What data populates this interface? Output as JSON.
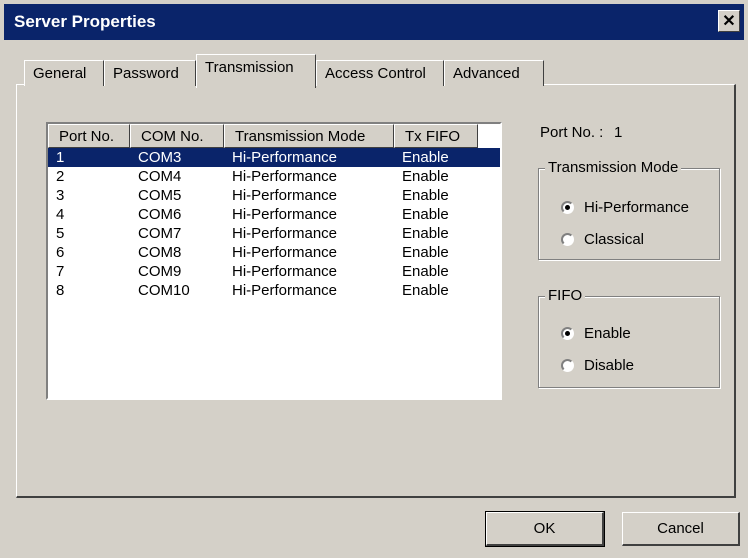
{
  "window": {
    "title": "Server Properties",
    "close_glyph": "✕"
  },
  "tabs": [
    {
      "label": "General",
      "active": false
    },
    {
      "label": "Password",
      "active": false
    },
    {
      "label": "Transmission",
      "active": true
    },
    {
      "label": "Access Control",
      "active": false
    },
    {
      "label": "Advanced",
      "active": false
    }
  ],
  "list": {
    "columns": [
      "Port No.",
      "COM No.",
      "Transmission Mode",
      "Tx FIFO"
    ],
    "rows": [
      {
        "port": "1",
        "com": "COM3",
        "mode": "Hi-Performance",
        "fifo": "Enable",
        "selected": true
      },
      {
        "port": "2",
        "com": "COM4",
        "mode": "Hi-Performance",
        "fifo": "Enable"
      },
      {
        "port": "3",
        "com": "COM5",
        "mode": "Hi-Performance",
        "fifo": "Enable"
      },
      {
        "port": "4",
        "com": "COM6",
        "mode": "Hi-Performance",
        "fifo": "Enable"
      },
      {
        "port": "5",
        "com": "COM7",
        "mode": "Hi-Performance",
        "fifo": "Enable"
      },
      {
        "port": "6",
        "com": "COM8",
        "mode": "Hi-Performance",
        "fifo": "Enable"
      },
      {
        "port": "7",
        "com": "COM9",
        "mode": "Hi-Performance",
        "fifo": "Enable"
      },
      {
        "port": "8",
        "com": "COM10",
        "mode": "Hi-Performance",
        "fifo": "Enable"
      }
    ]
  },
  "detail": {
    "port_label": "Port No. :",
    "port_value": "1",
    "transmission_mode": {
      "legend": "Transmission Mode",
      "options": [
        {
          "label": "Hi-Performance",
          "checked": true
        },
        {
          "label": "Classical",
          "checked": false
        }
      ]
    },
    "fifo": {
      "legend": "FIFO",
      "options": [
        {
          "label": "Enable",
          "checked": true
        },
        {
          "label": "Disable",
          "checked": false
        }
      ]
    }
  },
  "buttons": {
    "ok": "OK",
    "cancel": "Cancel"
  }
}
